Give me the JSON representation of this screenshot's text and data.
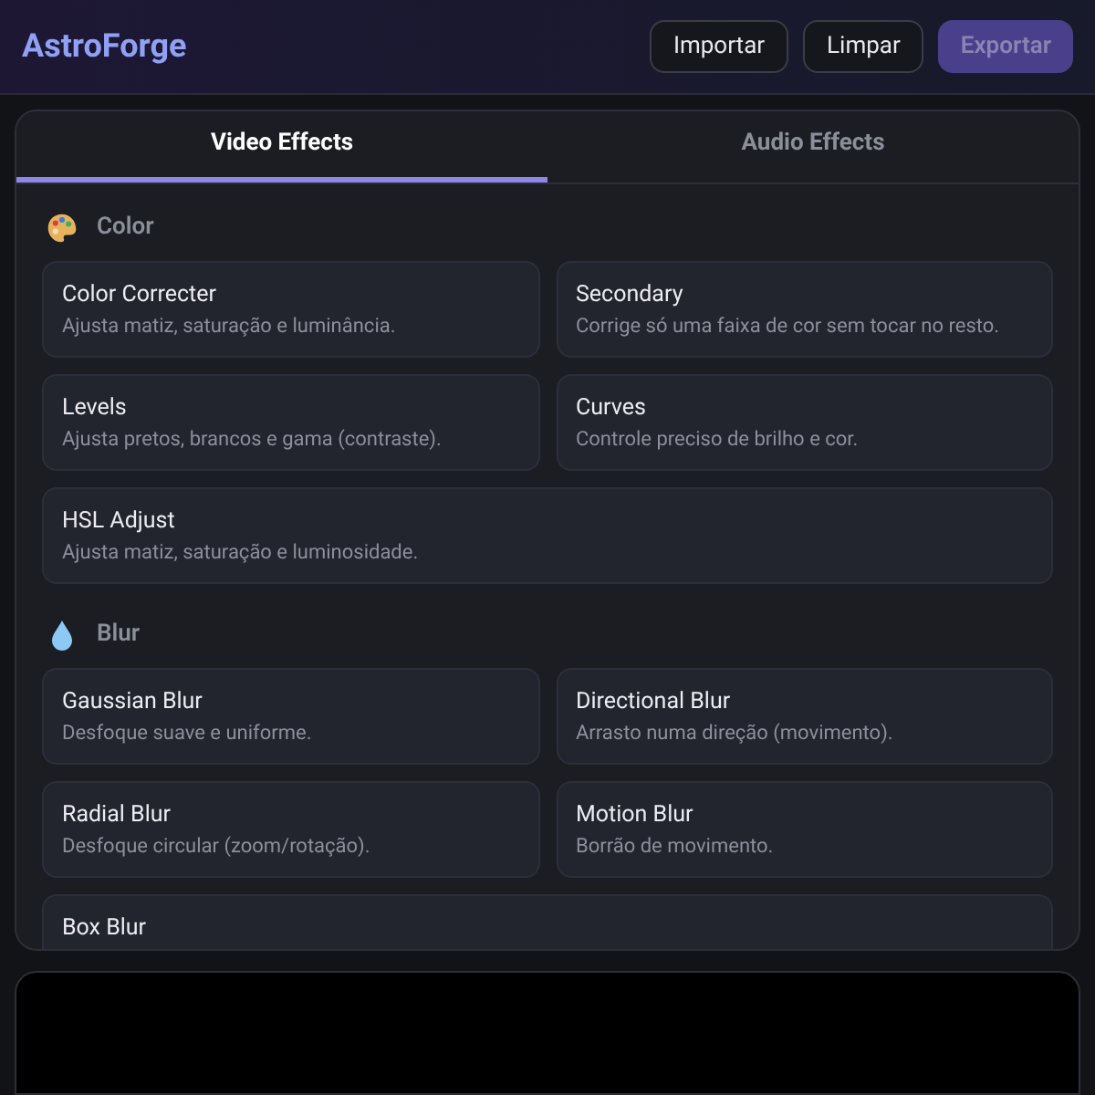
{
  "header": {
    "title": "AstroForge",
    "buttons": [
      {
        "label": "Importar",
        "disabled": false
      },
      {
        "label": "Limpar",
        "disabled": false
      },
      {
        "label": "Exportar",
        "disabled": true
      }
    ]
  },
  "tabs": [
    {
      "label": "Video Effects",
      "selected": true
    },
    {
      "label": "Audio Effects",
      "selected": false
    }
  ],
  "sections": [
    {
      "title": "Color",
      "effects": [
        {
          "name": "Color Correcter",
          "description": "Ajusta matiz, saturação e luminância.",
          "wide": false
        },
        {
          "name": "Secondary",
          "description": "Corrige só uma faixa de cor sem tocar no resto.",
          "wide": false
        },
        {
          "name": "Levels",
          "description": "Ajusta pretos, brancos e gama (contraste).",
          "wide": false
        },
        {
          "name": "Curves",
          "description": "Controle preciso de brilho e cor.",
          "wide": false
        },
        {
          "name": "HSL Adjust",
          "description": "Ajusta matiz, saturação e luminosidade.",
          "wide": true
        }
      ]
    },
    {
      "title": "Blur",
      "effects": [
        {
          "name": "Gaussian Blur",
          "description": "Desfoque suave e uniforme.",
          "wide": false
        },
        {
          "name": "Directional Blur",
          "description": "Arrasto numa direção (movimento).",
          "wide": false
        },
        {
          "name": "Radial Blur",
          "description": "Desfoque circular (zoom/rotação).",
          "wide": false
        },
        {
          "name": "Motion Blur",
          "description": "Borrão de movimento.",
          "wide": false
        },
        {
          "name": "Box Blur",
          "wide": true
        }
      ]
    }
  ]
}
